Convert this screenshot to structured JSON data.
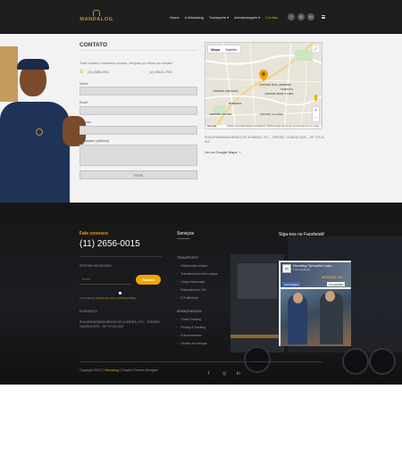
{
  "header": {
    "logo_text": "MANDALOG",
    "nav": [
      "Home",
      "A Mandalog",
      "Transporte ▾",
      "Armazenagem ▾",
      "Contato"
    ],
    "active_index": 4,
    "social_icons": [
      "facebook-icon",
      "instagram-icon",
      "linkedin-icon"
    ],
    "social_glyphs": [
      "f",
      "◎",
      "in"
    ]
  },
  "contact": {
    "title": "CONTATO",
    "intro": "Tente contato e iniciarmos prontos, obrigado por iniciar um contato!",
    "phone_1": "(11) 2656-0015",
    "phone_2": "(11) 96121-7993",
    "fields": [
      {
        "label": "Nome"
      },
      {
        "label": "Email"
      },
      {
        "label": "Assunto"
      },
      {
        "label": "Mensagem (optional)"
      }
    ],
    "submit_label": "ENVIE",
    "map": {
      "toggle": [
        "Mapa",
        "Satélite"
      ],
      "labels": [
        "JARDIM ADRIANA",
        "JARDIM BOM CLIMA",
        "JARDIM DOS AMORES",
        "TABOÃO",
        "MORROS",
        "JARDIM ARARA",
        "JARDIM ALFAMA"
      ],
      "footer": "Atalhos do teclado   Dados cartográficos ©2023 Google   Termos de uso   Informar erro no mapa",
      "google": "Google"
    },
    "address": "RUA ARMANDINA BRAGA DE ALMEIDA, 470 – TABOÃO, GUARULHOS – SP, 07141-003",
    "google_link": "Ver no Google Maps"
  },
  "footer": {
    "talk_title": "Fale conosco",
    "phone": "(11) 2656-0015",
    "newsletter_label": "RECEBA NOVIDADES",
    "newsletter_placeholder": "Email",
    "newsletter_button": "Submit",
    "consent_prefix": "Li e aceito os ",
    "consent_terms": "Termos de Uso",
    "consent_mid": " e a ",
    "consent_privacy": "Privacy Policy",
    "address_label": "ENDEREÇO",
    "address": "RUA ARMANDINA BRAGA DE ALMEIDA, 470 – TABOÃO, GUARULHOS – SP, 07141-003",
    "services_title": "Serviços",
    "services_heading_1": "TRANSPORTE",
    "services_group_1": [
      "Distribuição urbana",
      "Transferência entre cargas",
      "Carga fracionada",
      "Rastreamento 24h",
      "E-Fulfillment"
    ],
    "services_heading_2": "ARMAZENAGEM",
    "services_group_2": [
      "Cross Docking",
      "Picking & Packing",
      "Fracionamento",
      "Gestão de estoque"
    ],
    "fb_title": "Siga-nos no Facebook!",
    "fb_name": "Mandalog Operações Logís...",
    "fb_followers": "1.012 seguidores",
    "fb_brand": "MANDALOG",
    "fb_like": "Curtir Página",
    "fb_share": "Compartilhar",
    "copyright_prefix": "Copyright 2023 © ",
    "copyright_brand": "Mandalog",
    "copyright_suffix": " | Criação: Ferreira Designer",
    "social_glyphs": [
      "f",
      "◎",
      "in"
    ]
  }
}
